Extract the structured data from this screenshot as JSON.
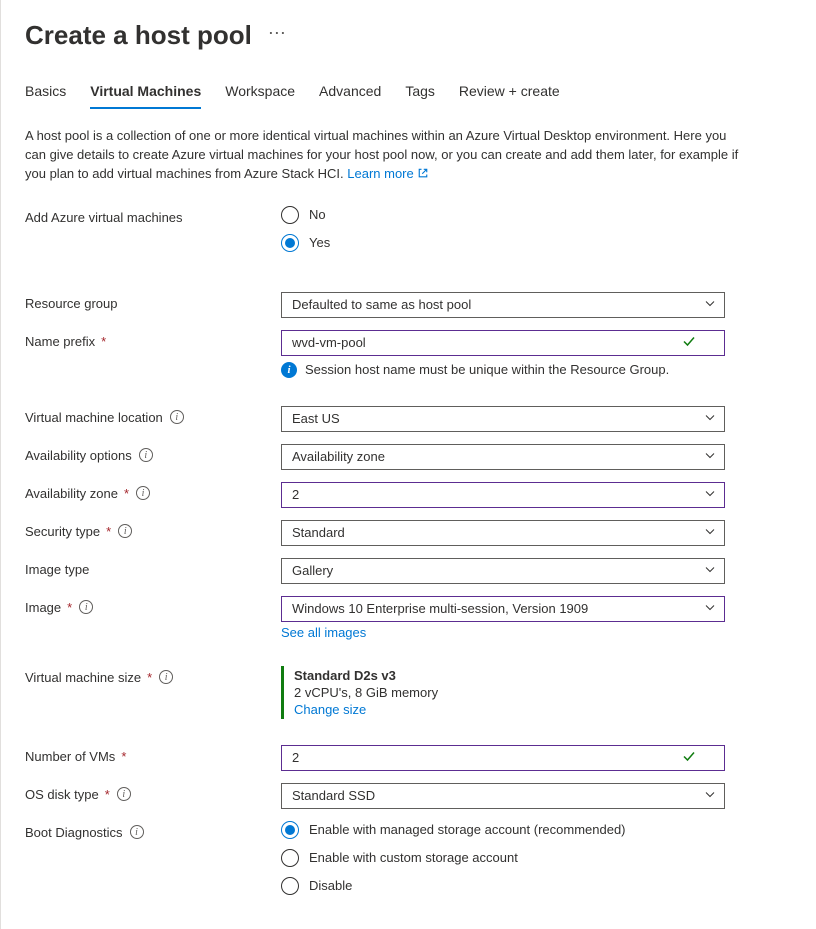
{
  "header": {
    "title": "Create a host pool"
  },
  "tabs": [
    {
      "label": "Basics",
      "active": false
    },
    {
      "label": "Virtual Machines",
      "active": true
    },
    {
      "label": "Workspace",
      "active": false
    },
    {
      "label": "Advanced",
      "active": false
    },
    {
      "label": "Tags",
      "active": false
    },
    {
      "label": "Review + create",
      "active": false
    }
  ],
  "description": {
    "text": "A host pool is a collection of one or more identical virtual machines within an Azure Virtual Desktop environment. Here you can give details to create Azure virtual machines for your host pool now, or you can create and add them later, for example if you plan to add virtual machines from Azure Stack HCI. ",
    "link_text": "Learn more"
  },
  "fields": {
    "add_vms": {
      "label": "Add Azure virtual machines",
      "options": [
        {
          "label": "No",
          "selected": false
        },
        {
          "label": "Yes",
          "selected": true
        }
      ]
    },
    "resource_group": {
      "label": "Resource group",
      "value": "Defaulted to same as host pool"
    },
    "name_prefix": {
      "label": "Name prefix",
      "value": "wvd-vm-pool",
      "info_message": "Session host name must be unique within the Resource Group."
    },
    "vm_location": {
      "label": "Virtual machine location",
      "value": "East US"
    },
    "availability_options": {
      "label": "Availability options",
      "value": "Availability zone"
    },
    "availability_zone": {
      "label": "Availability zone",
      "value": "2"
    },
    "security_type": {
      "label": "Security type",
      "value": "Standard"
    },
    "image_type": {
      "label": "Image type",
      "value": "Gallery"
    },
    "image": {
      "label": "Image",
      "value": "Windows 10 Enterprise multi-session, Version 1909",
      "sublink": "See all images"
    },
    "vm_size": {
      "label": "Virtual machine size",
      "title": "Standard D2s v3",
      "details": "2 vCPU's, 8 GiB memory",
      "link": "Change size"
    },
    "num_vms": {
      "label": "Number of VMs",
      "value": "2"
    },
    "os_disk_type": {
      "label": "OS disk type",
      "value": "Standard SSD"
    },
    "boot_diagnostics": {
      "label": "Boot Diagnostics",
      "options": [
        {
          "label": "Enable with managed storage account (recommended)",
          "selected": true
        },
        {
          "label": "Enable with custom storage account",
          "selected": false
        },
        {
          "label": "Disable",
          "selected": false
        }
      ]
    }
  }
}
